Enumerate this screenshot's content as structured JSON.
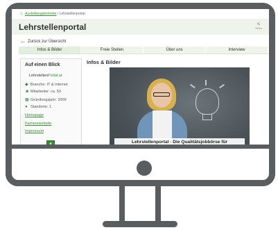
{
  "breadcrumb": {
    "home_icon": "house-icon",
    "first": "Ausbildungsbetriebe",
    "separator": "/",
    "current": "Lehrstellenportal"
  },
  "header": {
    "title": "Lehrstellenportal",
    "share_icon": "share-icon",
    "share_label": "Teilen"
  },
  "back_link": {
    "label": "Zurück zur Übersicht",
    "icon": "arrow-left-icon"
  },
  "tabs": [
    {
      "label": "Infos & Bilder"
    },
    {
      "label": "Freie Stellen"
    },
    {
      "label": "Über uns"
    },
    {
      "label": "Interview"
    }
  ],
  "sidebar": {
    "title": "Auf einen Blick",
    "logo_text_a": "Lehrstellen",
    "logo_text_b": "Portal.at",
    "facts": [
      {
        "icon": "tag-icon",
        "text": "Branche: IT & Internet"
      },
      {
        "icon": "people-icon",
        "text": "Mitarbeiter: ca. 50"
      },
      {
        "icon": "calendar-icon",
        "text": "Gründungsjahr: 2009"
      },
      {
        "icon": "location-pin-icon",
        "text": "Standorte: 1"
      }
    ],
    "links": [
      "Homepage",
      "Karrierewebsite",
      "Impressum"
    ],
    "social_icon": "facebook-icon"
  },
  "main": {
    "title": "Infos & Bilder",
    "caption": "Lehrstellenportal - Die Qualitätsjobbörse für"
  },
  "colors": {
    "accent": "#3c8a3c",
    "frame": "#5a5d60",
    "tab_bg": "#eef4ec"
  }
}
